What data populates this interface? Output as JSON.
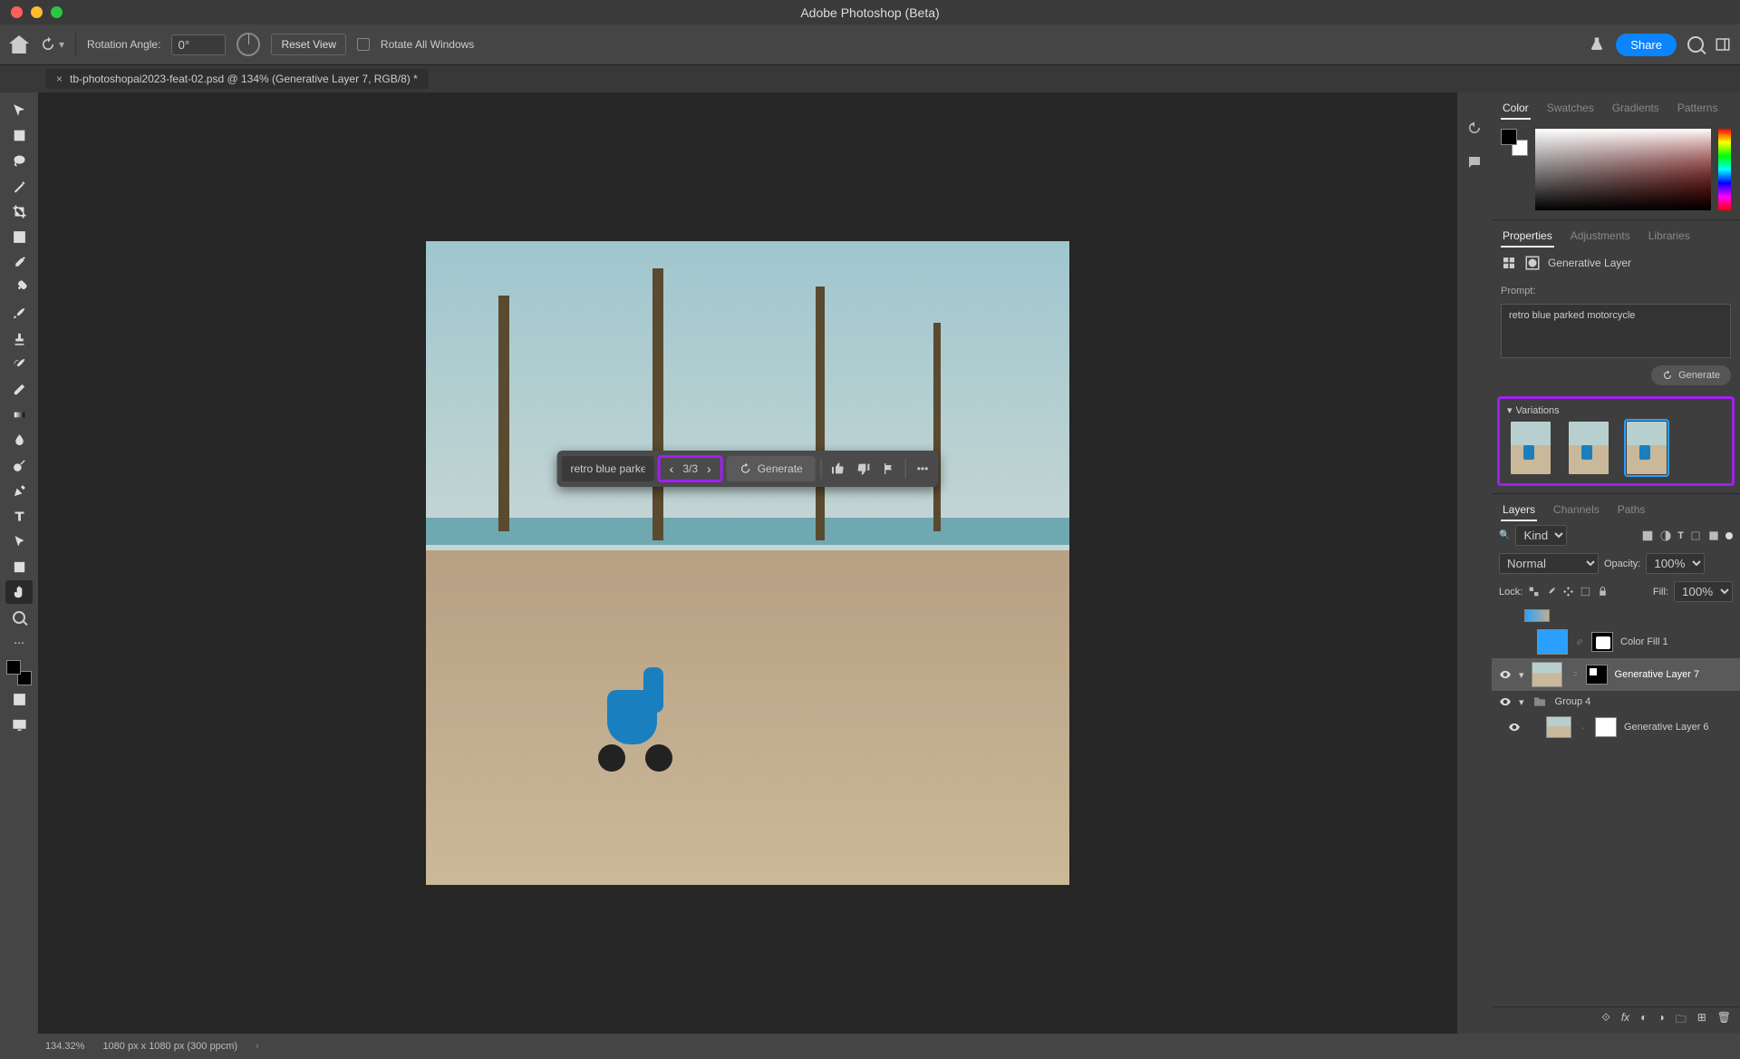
{
  "app_title": "Adobe Photoshop (Beta)",
  "options": {
    "rotation_label": "Rotation Angle:",
    "rotation_value": "0°",
    "reset_view": "Reset View",
    "rotate_all": "Rotate All Windows",
    "share": "Share"
  },
  "document_tab": "tb-photoshopai2023-feat-02.psd @ 134% (Generative Layer 7, RGB/8) *",
  "context_bar": {
    "prompt_preview": "retro blue parke...",
    "pager": "3/3",
    "generate": "Generate"
  },
  "right": {
    "color_tabs": [
      "Color",
      "Swatches",
      "Gradients",
      "Patterns"
    ],
    "prop_tabs": [
      "Properties",
      "Adjustments",
      "Libraries"
    ],
    "layer_type": "Generative Layer",
    "prompt_label": "Prompt:",
    "prompt_text": "retro blue parked motorcycle",
    "generate": "Generate",
    "variations_label": "Variations",
    "layer_tabs": [
      "Layers",
      "Channels",
      "Paths"
    ],
    "kind": "Kind",
    "blend_mode": "Normal",
    "opacity_label": "Opacity:",
    "opacity_value": "100%",
    "lock_label": "Lock:",
    "fill_label": "Fill:",
    "fill_value": "100%",
    "layers": [
      {
        "name": "Color Fill 1",
        "selected": false,
        "visible": false,
        "thumb": "#2b9fff"
      },
      {
        "name": "Generative Layer 7",
        "selected": true,
        "visible": true,
        "thumb": "#c0b090"
      },
      {
        "name": "Group 4",
        "selected": false,
        "visible": true,
        "group": true
      },
      {
        "name": "Generative Layer 6",
        "selected": false,
        "visible": true,
        "thumb": "#c0b090",
        "indent": true
      }
    ]
  },
  "status": {
    "zoom": "134.32%",
    "dims": "1080 px x 1080 px (300 ppcm)"
  },
  "tools": [
    "move",
    "marquee",
    "lasso",
    "wand",
    "crop",
    "frame",
    "eyedropper",
    "heal",
    "brush",
    "stamp",
    "history",
    "eraser",
    "gradient",
    "blur",
    "dodge",
    "pen",
    "type",
    "path-sel",
    "rect",
    "hand",
    "rotate-view",
    "zoom",
    "more"
  ],
  "tool_selected": "rotate-view"
}
